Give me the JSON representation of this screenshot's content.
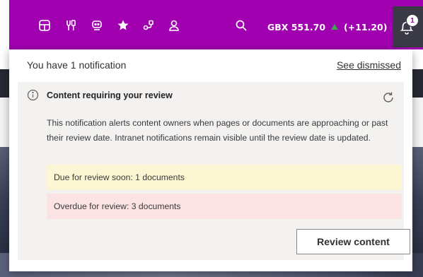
{
  "topbar": {
    "background": "#a100b0",
    "icons": [
      "layout-icon",
      "tools-icon",
      "message-robot-icon",
      "star-icon",
      "flow-icon",
      "person-icon",
      "search-icon"
    ],
    "stock": {
      "ticker": "GBX 551.70",
      "change": "(+11.20)",
      "trend": "up",
      "trend_color": "#3fa84a"
    },
    "notifications": {
      "badge_count": "1",
      "button_color": "#3a3a46"
    }
  },
  "panel": {
    "count_text": "You have 1 notification",
    "see_dismissed": "See dismissed",
    "card": {
      "title": "Content requiring your review",
      "body": "This notification alerts content owners when pages or documents are approaching or past their review date. Intranet notifications remain visible until the review date is updated.",
      "due_soon": "Due for review soon: 1 documents",
      "due_soon_color": "#fdf6d2",
      "overdue": "Overdue for review: 3 documents",
      "overdue_color": "#fbe3e4",
      "action_label": "Review content"
    }
  }
}
